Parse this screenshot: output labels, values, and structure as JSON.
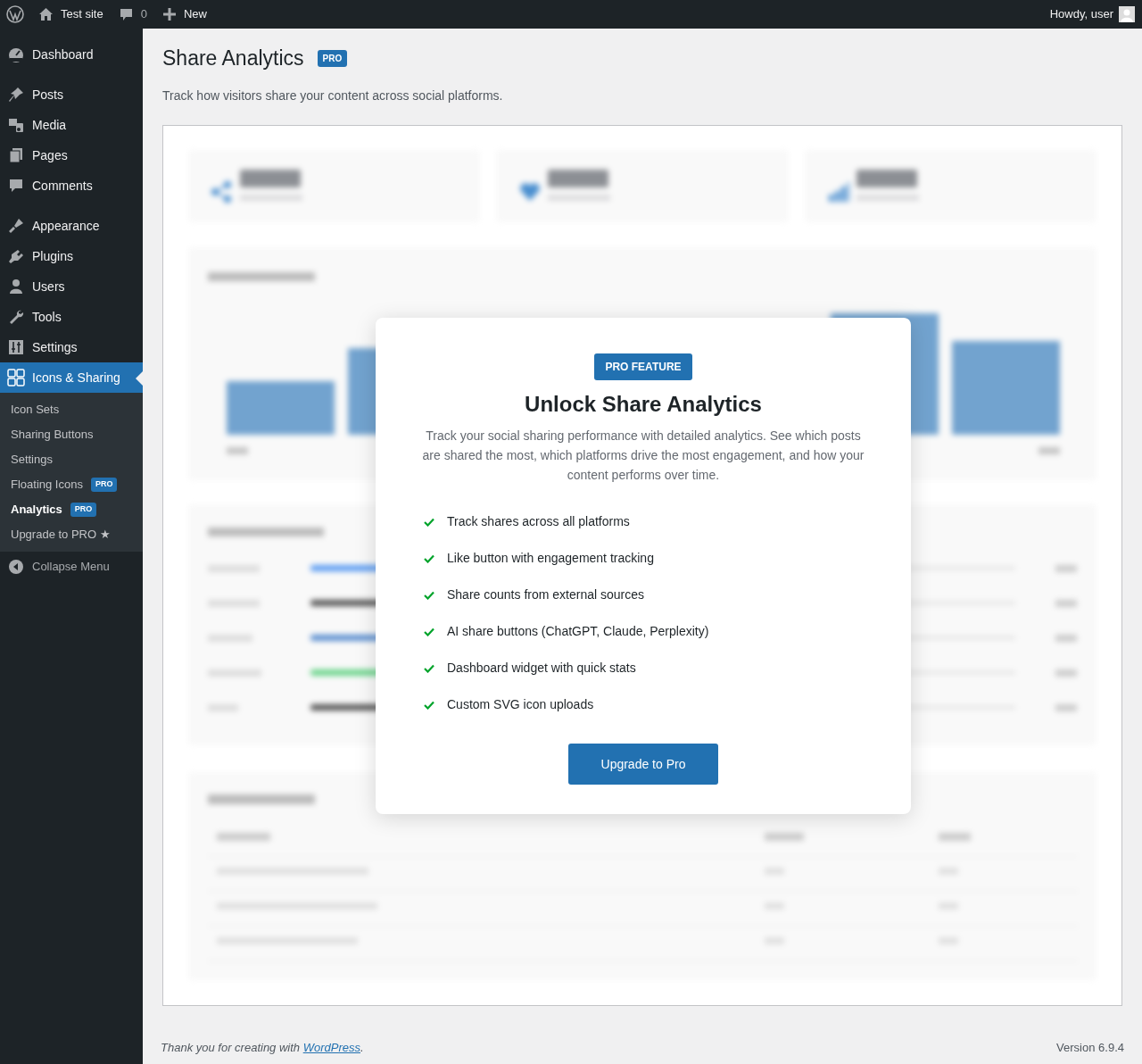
{
  "admin_bar": {
    "site": "Test site",
    "comments": "0",
    "new": "New",
    "greeting": "Howdy, user"
  },
  "sidebar": {
    "groups": [
      {
        "items": [
          {
            "label": "Dashboard",
            "kind": "dashboard",
            "selected": false
          }
        ]
      },
      {
        "items": [
          {
            "label": "Posts",
            "kind": "posts",
            "selected": false
          },
          {
            "label": "Media",
            "kind": "media",
            "selected": false
          },
          {
            "label": "Pages",
            "kind": "pages",
            "selected": false
          },
          {
            "label": "Comments",
            "kind": "comments",
            "selected": false
          }
        ]
      },
      {
        "items": [
          {
            "label": "Appearance",
            "kind": "appearance",
            "selected": false
          },
          {
            "label": "Plugins",
            "kind": "plugins",
            "selected": false
          },
          {
            "label": "Users",
            "kind": "users",
            "selected": false
          },
          {
            "label": "Tools",
            "kind": "tools",
            "selected": false
          },
          {
            "label": "Settings",
            "kind": "settings",
            "selected": false
          },
          {
            "label": "Icons & Sharing",
            "kind": "sharing",
            "selected": true
          }
        ]
      }
    ],
    "submenu": [
      {
        "label": "Icon Sets",
        "selected": false
      },
      {
        "label": "Sharing Buttons",
        "selected": false
      },
      {
        "label": "Settings",
        "selected": false
      },
      {
        "label": "Floating Icons",
        "badge": "PRO",
        "selected": false
      },
      {
        "label": "Analytics",
        "badge": "PRO",
        "selected": true
      },
      {
        "label": "Upgrade to PRO ★",
        "selected": false
      }
    ],
    "collapse": "Collapse Menu"
  },
  "page": {
    "title": "Share Analytics",
    "badge": "PRO",
    "description": "Track how visitors share your content across social platforms."
  },
  "preview": {
    "stats": [
      {
        "kind": "share"
      },
      {
        "kind": "heart"
      },
      {
        "kind": "bars"
      }
    ]
  },
  "modal": {
    "badge": "PRO FEATURE",
    "title": "Unlock Share Analytics",
    "text": "Track your social sharing performance with detailed analytics. See which posts are shared the most, which platforms drive the most engagement, and how your content performs over time.",
    "features": [
      "Track shares across all platforms",
      "Like button with engagement tracking",
      "Share counts from external sources",
      "AI share buttons (ChatGPT, Claude, Perplexity)",
      "Dashboard widget with quick stats",
      "Custom SVG icon uploads"
    ],
    "button": "Upgrade to Pro"
  },
  "footer": {
    "text": "Thank you for creating with ",
    "link": "WordPress",
    "end": ".",
    "version": "Version 6.9.4"
  }
}
